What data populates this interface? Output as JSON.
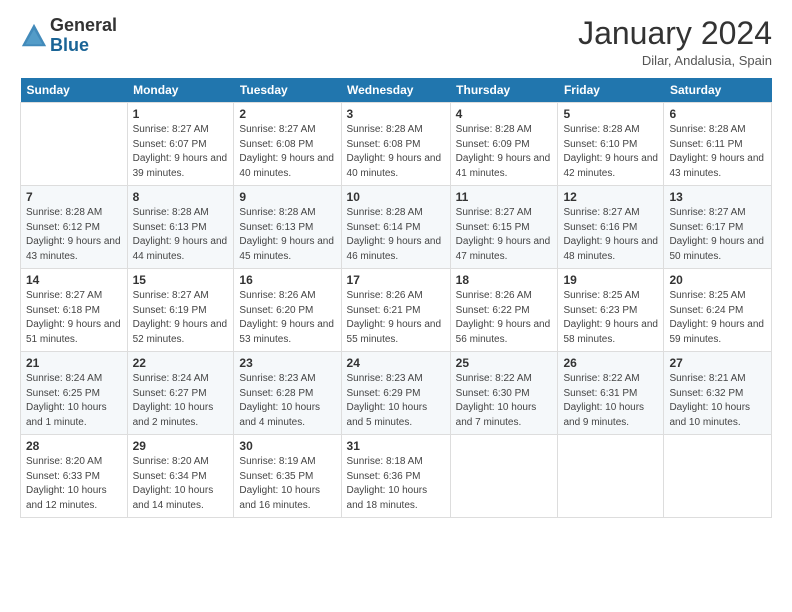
{
  "header": {
    "logo_general": "General",
    "logo_blue": "Blue",
    "month_title": "January 2024",
    "location": "Dilar, Andalusia, Spain"
  },
  "weekdays": [
    "Sunday",
    "Monday",
    "Tuesday",
    "Wednesday",
    "Thursday",
    "Friday",
    "Saturday"
  ],
  "weeks": [
    [
      {
        "day": "",
        "sunrise": "",
        "sunset": "",
        "daylight": ""
      },
      {
        "day": "1",
        "sunrise": "Sunrise: 8:27 AM",
        "sunset": "Sunset: 6:07 PM",
        "daylight": "Daylight: 9 hours and 39 minutes."
      },
      {
        "day": "2",
        "sunrise": "Sunrise: 8:27 AM",
        "sunset": "Sunset: 6:08 PM",
        "daylight": "Daylight: 9 hours and 40 minutes."
      },
      {
        "day": "3",
        "sunrise": "Sunrise: 8:28 AM",
        "sunset": "Sunset: 6:08 PM",
        "daylight": "Daylight: 9 hours and 40 minutes."
      },
      {
        "day": "4",
        "sunrise": "Sunrise: 8:28 AM",
        "sunset": "Sunset: 6:09 PM",
        "daylight": "Daylight: 9 hours and 41 minutes."
      },
      {
        "day": "5",
        "sunrise": "Sunrise: 8:28 AM",
        "sunset": "Sunset: 6:10 PM",
        "daylight": "Daylight: 9 hours and 42 minutes."
      },
      {
        "day": "6",
        "sunrise": "Sunrise: 8:28 AM",
        "sunset": "Sunset: 6:11 PM",
        "daylight": "Daylight: 9 hours and 43 minutes."
      }
    ],
    [
      {
        "day": "7",
        "sunrise": "Sunrise: 8:28 AM",
        "sunset": "Sunset: 6:12 PM",
        "daylight": "Daylight: 9 hours and 43 minutes."
      },
      {
        "day": "8",
        "sunrise": "Sunrise: 8:28 AM",
        "sunset": "Sunset: 6:13 PM",
        "daylight": "Daylight: 9 hours and 44 minutes."
      },
      {
        "day": "9",
        "sunrise": "Sunrise: 8:28 AM",
        "sunset": "Sunset: 6:13 PM",
        "daylight": "Daylight: 9 hours and 45 minutes."
      },
      {
        "day": "10",
        "sunrise": "Sunrise: 8:28 AM",
        "sunset": "Sunset: 6:14 PM",
        "daylight": "Daylight: 9 hours and 46 minutes."
      },
      {
        "day": "11",
        "sunrise": "Sunrise: 8:27 AM",
        "sunset": "Sunset: 6:15 PM",
        "daylight": "Daylight: 9 hours and 47 minutes."
      },
      {
        "day": "12",
        "sunrise": "Sunrise: 8:27 AM",
        "sunset": "Sunset: 6:16 PM",
        "daylight": "Daylight: 9 hours and 48 minutes."
      },
      {
        "day": "13",
        "sunrise": "Sunrise: 8:27 AM",
        "sunset": "Sunset: 6:17 PM",
        "daylight": "Daylight: 9 hours and 50 minutes."
      }
    ],
    [
      {
        "day": "14",
        "sunrise": "Sunrise: 8:27 AM",
        "sunset": "Sunset: 6:18 PM",
        "daylight": "Daylight: 9 hours and 51 minutes."
      },
      {
        "day": "15",
        "sunrise": "Sunrise: 8:27 AM",
        "sunset": "Sunset: 6:19 PM",
        "daylight": "Daylight: 9 hours and 52 minutes."
      },
      {
        "day": "16",
        "sunrise": "Sunrise: 8:26 AM",
        "sunset": "Sunset: 6:20 PM",
        "daylight": "Daylight: 9 hours and 53 minutes."
      },
      {
        "day": "17",
        "sunrise": "Sunrise: 8:26 AM",
        "sunset": "Sunset: 6:21 PM",
        "daylight": "Daylight: 9 hours and 55 minutes."
      },
      {
        "day": "18",
        "sunrise": "Sunrise: 8:26 AM",
        "sunset": "Sunset: 6:22 PM",
        "daylight": "Daylight: 9 hours and 56 minutes."
      },
      {
        "day": "19",
        "sunrise": "Sunrise: 8:25 AM",
        "sunset": "Sunset: 6:23 PM",
        "daylight": "Daylight: 9 hours and 58 minutes."
      },
      {
        "day": "20",
        "sunrise": "Sunrise: 8:25 AM",
        "sunset": "Sunset: 6:24 PM",
        "daylight": "Daylight: 9 hours and 59 minutes."
      }
    ],
    [
      {
        "day": "21",
        "sunrise": "Sunrise: 8:24 AM",
        "sunset": "Sunset: 6:25 PM",
        "daylight": "Daylight: 10 hours and 1 minute."
      },
      {
        "day": "22",
        "sunrise": "Sunrise: 8:24 AM",
        "sunset": "Sunset: 6:27 PM",
        "daylight": "Daylight: 10 hours and 2 minutes."
      },
      {
        "day": "23",
        "sunrise": "Sunrise: 8:23 AM",
        "sunset": "Sunset: 6:28 PM",
        "daylight": "Daylight: 10 hours and 4 minutes."
      },
      {
        "day": "24",
        "sunrise": "Sunrise: 8:23 AM",
        "sunset": "Sunset: 6:29 PM",
        "daylight": "Daylight: 10 hours and 5 minutes."
      },
      {
        "day": "25",
        "sunrise": "Sunrise: 8:22 AM",
        "sunset": "Sunset: 6:30 PM",
        "daylight": "Daylight: 10 hours and 7 minutes."
      },
      {
        "day": "26",
        "sunrise": "Sunrise: 8:22 AM",
        "sunset": "Sunset: 6:31 PM",
        "daylight": "Daylight: 10 hours and 9 minutes."
      },
      {
        "day": "27",
        "sunrise": "Sunrise: 8:21 AM",
        "sunset": "Sunset: 6:32 PM",
        "daylight": "Daylight: 10 hours and 10 minutes."
      }
    ],
    [
      {
        "day": "28",
        "sunrise": "Sunrise: 8:20 AM",
        "sunset": "Sunset: 6:33 PM",
        "daylight": "Daylight: 10 hours and 12 minutes."
      },
      {
        "day": "29",
        "sunrise": "Sunrise: 8:20 AM",
        "sunset": "Sunset: 6:34 PM",
        "daylight": "Daylight: 10 hours and 14 minutes."
      },
      {
        "day": "30",
        "sunrise": "Sunrise: 8:19 AM",
        "sunset": "Sunset: 6:35 PM",
        "daylight": "Daylight: 10 hours and 16 minutes."
      },
      {
        "day": "31",
        "sunrise": "Sunrise: 8:18 AM",
        "sunset": "Sunset: 6:36 PM",
        "daylight": "Daylight: 10 hours and 18 minutes."
      },
      {
        "day": "",
        "sunrise": "",
        "sunset": "",
        "daylight": ""
      },
      {
        "day": "",
        "sunrise": "",
        "sunset": "",
        "daylight": ""
      },
      {
        "day": "",
        "sunrise": "",
        "sunset": "",
        "daylight": ""
      }
    ]
  ]
}
